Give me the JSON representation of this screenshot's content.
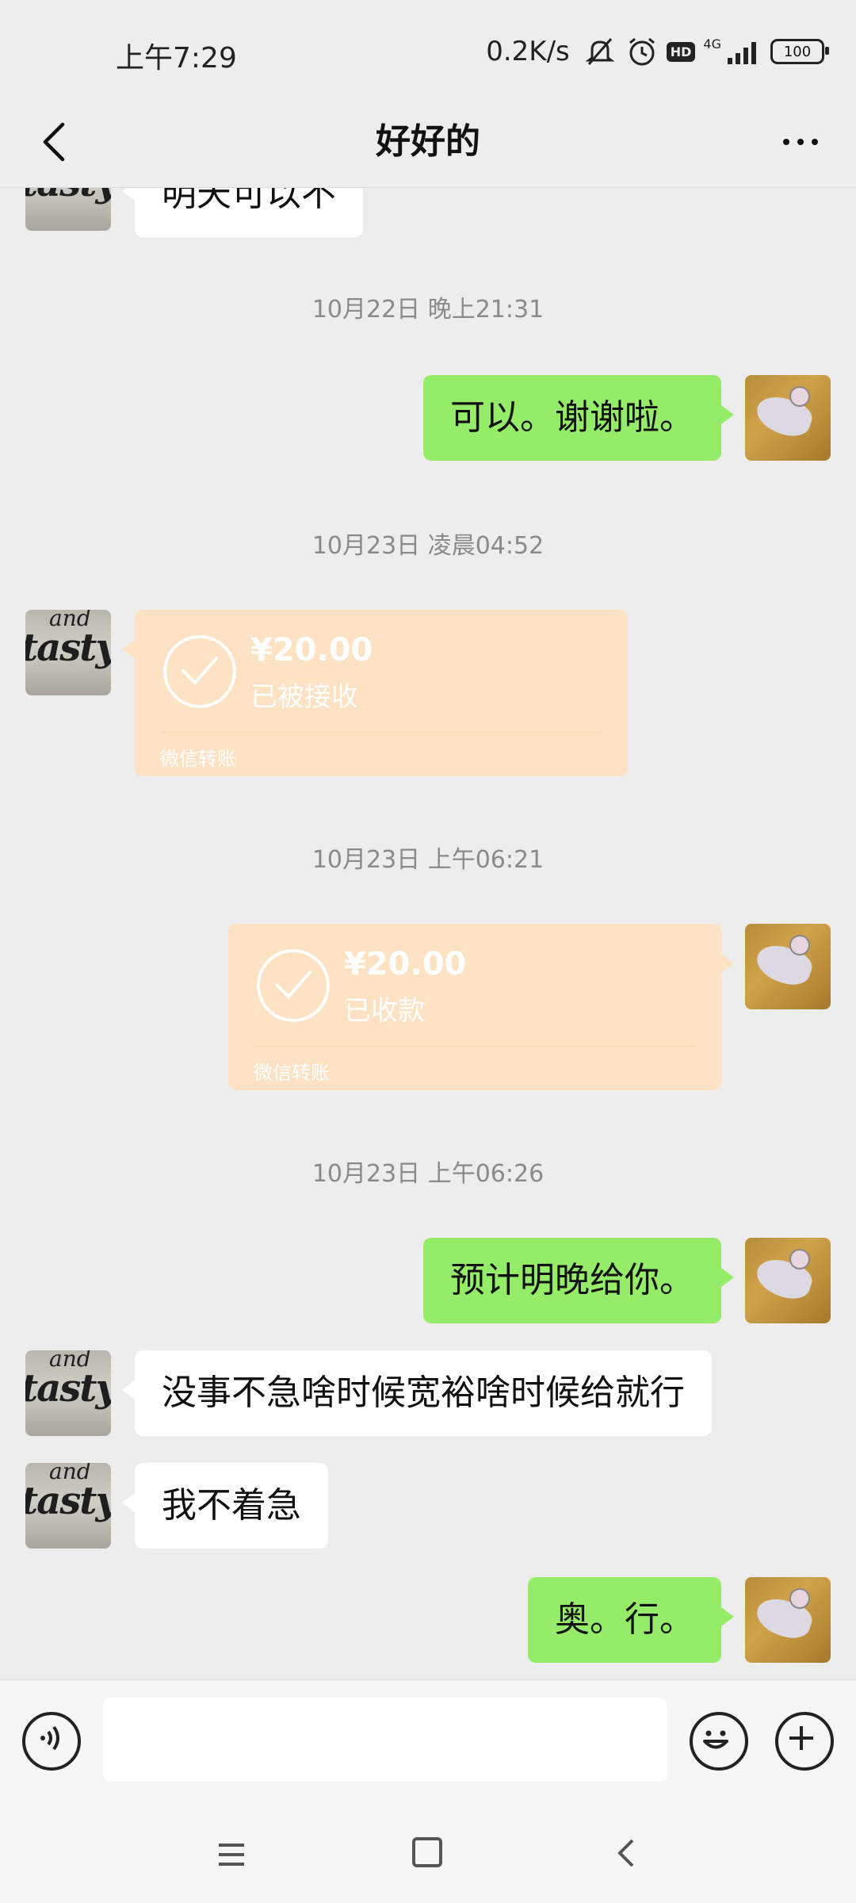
{
  "status_bar": {
    "time": "上午7:29",
    "net_speed": "0.2K/s",
    "hd": "HD",
    "signal_label": "4G",
    "battery": "100"
  },
  "header": {
    "title": "好好的"
  },
  "messages": {
    "partial_top": "明天可以不",
    "ts1": "10月22日 晚上21:31",
    "m1": "可以。谢谢啦。",
    "ts2": "10月23日 凌晨04:52",
    "transfer1": {
      "amount": "¥20.00",
      "status": "已被接收",
      "footer": "微信转账"
    },
    "ts3": "10月23日 上午06:21",
    "transfer2": {
      "amount": "¥20.00",
      "status": "已收款",
      "footer": "微信转账"
    },
    "ts4": "10月23日 上午06:26",
    "m2": "预计明晚给你。",
    "m3": "没事不急啥时候宽裕啥时候给就行",
    "m4": "我不着急",
    "m5": "奥。行。"
  },
  "avatar_text": {
    "line1": "and",
    "line2": "tasty"
  },
  "colors": {
    "background": "#ededed",
    "green_bubble": "#95ec69",
    "white_bubble": "#ffffff",
    "transfer_card": "#fde2c4",
    "timestamp": "#8a8a8a"
  }
}
